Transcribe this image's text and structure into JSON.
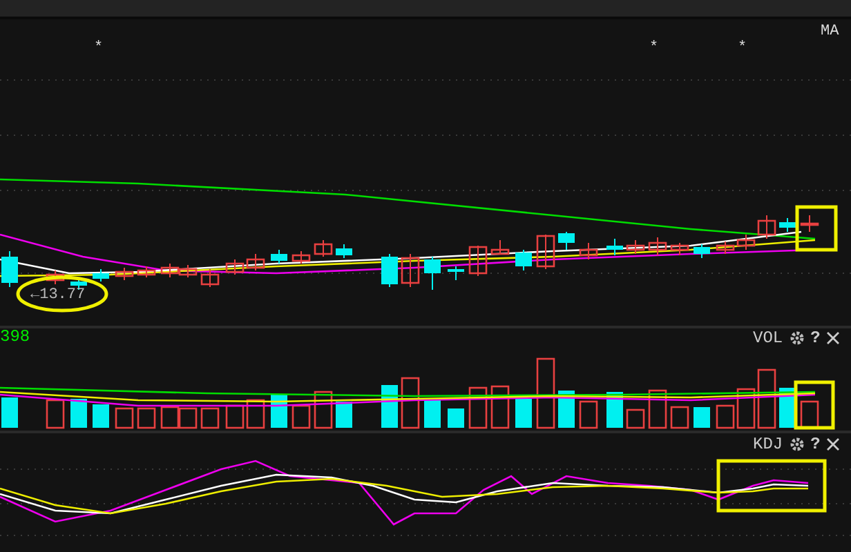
{
  "main_panel": {
    "markers": [
      "*",
      "*",
      "*"
    ],
    "indicator_label": "MA",
    "price_label": "←13.77"
  },
  "volume_panel": {
    "value": "398",
    "label": "VOL",
    "help": "?"
  },
  "kdj_panel": {
    "label": "KDJ",
    "help": "?"
  }
}
